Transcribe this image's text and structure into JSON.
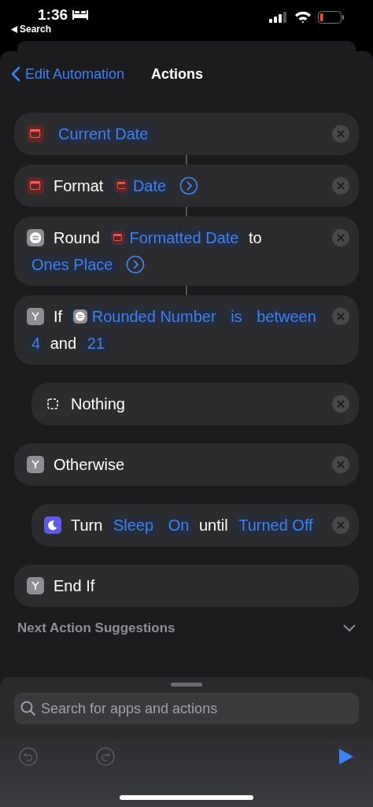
{
  "status_bar": {
    "time": "1:36",
    "back_label": "Search"
  },
  "nav": {
    "back": "Edit Automation",
    "title": "Actions"
  },
  "actions": [
    {
      "kind": "calendar",
      "linked": true,
      "removable": true,
      "tokens": [
        {
          "kind": "var",
          "text": "Current Date"
        }
      ]
    },
    {
      "kind": "calendar",
      "linked": true,
      "removable": true,
      "tokens": [
        {
          "kind": "text",
          "text": "Format"
        },
        {
          "kind": "calendar-var",
          "text": "Date"
        },
        {
          "kind": "more"
        }
      ]
    },
    {
      "kind": "equals",
      "linked": true,
      "removable": true,
      "tokens": [
        {
          "kind": "text",
          "text": "Round"
        },
        {
          "kind": "calendar-var",
          "text": "Formatted Date"
        },
        {
          "kind": "text",
          "text": "to"
        },
        {
          "kind": "var",
          "text": "Ones Place"
        },
        {
          "kind": "more"
        }
      ]
    },
    {
      "kind": "branch",
      "linked": false,
      "removable": true,
      "tokens": [
        {
          "kind": "text",
          "text": "If"
        },
        {
          "kind": "equals-var",
          "text": "Rounded Number"
        },
        {
          "kind": "var",
          "text": "is"
        },
        {
          "kind": "var",
          "text": "between"
        },
        {
          "kind": "var",
          "text": "4"
        },
        {
          "kind": "text",
          "text": "and"
        },
        {
          "kind": "var",
          "text": "21"
        }
      ],
      "children": [
        {
          "kind": "dotted",
          "linked": false,
          "removable": true,
          "tokens": [
            {
              "kind": "text",
              "text": "Nothing"
            }
          ]
        }
      ]
    },
    {
      "kind": "branch",
      "linked": false,
      "removable": true,
      "tokens": [
        {
          "kind": "text",
          "text": "Otherwise"
        }
      ],
      "children": [
        {
          "kind": "moon",
          "linked": false,
          "removable": true,
          "tokens": [
            {
              "kind": "text",
              "text": "Turn"
            },
            {
              "kind": "var",
              "text": "Sleep"
            },
            {
              "kind": "var",
              "text": "On"
            },
            {
              "kind": "text",
              "text": "until"
            },
            {
              "kind": "var",
              "text": "Turned Off"
            }
          ]
        }
      ]
    },
    {
      "kind": "branch",
      "linked": false,
      "removable": false,
      "tokens": [
        {
          "kind": "text",
          "text": "End If"
        }
      ]
    }
  ],
  "suggestions": {
    "title": "Next Action Suggestions"
  },
  "search": {
    "placeholder": "Search for apps and actions"
  }
}
